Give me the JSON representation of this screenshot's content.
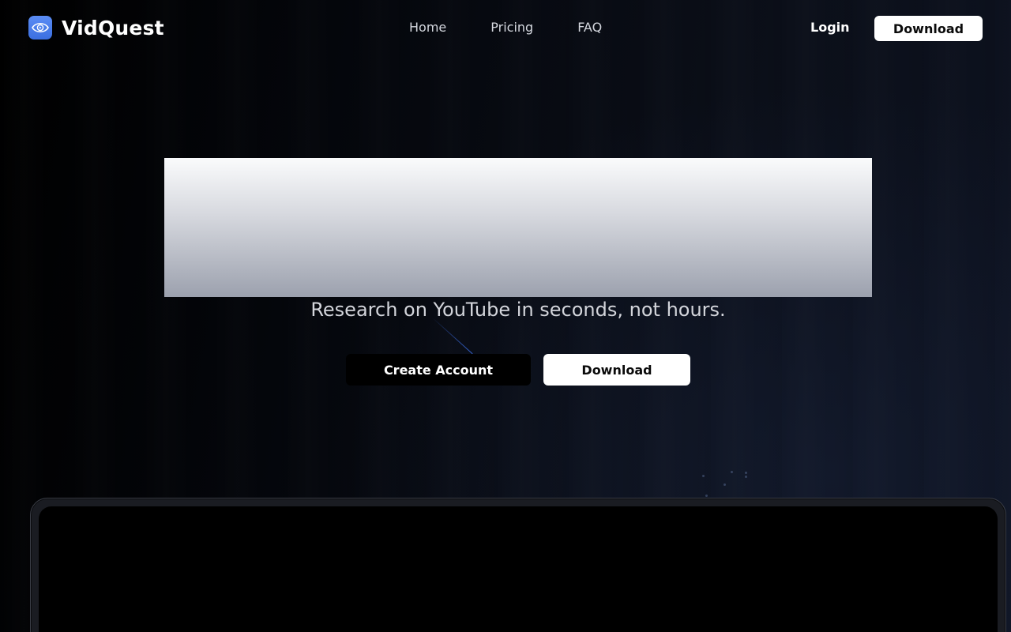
{
  "brand": {
    "name": "VidQuest",
    "icon": "eye-icon",
    "accent": "#4a7ff0"
  },
  "nav": {
    "items": [
      {
        "label": "Home"
      },
      {
        "label": "Pricing"
      },
      {
        "label": "FAQ"
      }
    ],
    "login_label": "Login",
    "download_label": "Download"
  },
  "hero": {
    "subtitle": "Research on YouTube in seconds, not hours.",
    "create_account_label": "Create Account",
    "download_label": "Download"
  }
}
